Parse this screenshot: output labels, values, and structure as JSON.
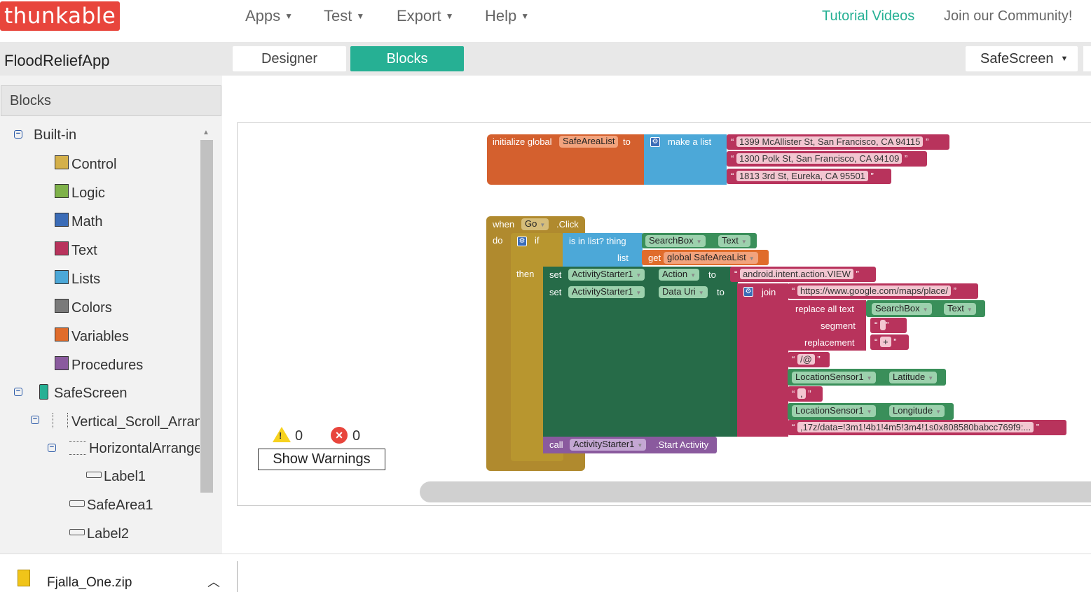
{
  "topbar": {
    "logo": "thunkable",
    "menus": [
      "Apps",
      "Test",
      "Export",
      "Help"
    ],
    "tutorial": "Tutorial Videos",
    "community": "Join our Community!"
  },
  "project": {
    "name": "FloodReliefApp",
    "tabs": {
      "designer": "Designer",
      "blocks": "Blocks"
    },
    "screen": "SafeScreen"
  },
  "sidebar": {
    "title": "Blocks",
    "builtin": "Built-in",
    "builtin_items": [
      {
        "label": "Control",
        "color": "#d4b04a"
      },
      {
        "label": "Logic",
        "color": "#7fb24a"
      },
      {
        "label": "Math",
        "color": "#3b6cb7"
      },
      {
        "label": "Text",
        "color": "#b8335c"
      },
      {
        "label": "Lists",
        "color": "#4ca8d8"
      },
      {
        "label": "Colors",
        "color": "#7a7a7a"
      },
      {
        "label": "Variables",
        "color": "#e06c2b"
      },
      {
        "label": "Procedures",
        "color": "#8a5a9e"
      }
    ],
    "components": {
      "screen": "SafeScreen",
      "vsa": "Vertical_Scroll_Arran",
      "ha": "HorizontalArrange",
      "label1": "Label1",
      "safearea1": "SafeArea1",
      "label2": "Label2"
    }
  },
  "warnings": {
    "warning_count": "0",
    "error_count": "0",
    "button": "Show Warnings"
  },
  "download": {
    "filename": "Fjalla_One.zip"
  },
  "blocks": {
    "init": {
      "prefix": "initialize global",
      "var": "SafeAreaList",
      "to": "to",
      "make_list": "make a list",
      "items": [
        "1399 McAllister St, San Francisco, CA 94115",
        "1300 Polk St, San Francisco, CA 94109",
        "1813 3rd St, Eureka, CA 95501"
      ]
    },
    "event": {
      "when": "when",
      "component": "Go",
      "event": ".Click",
      "do": "do",
      "if": "if",
      "then": "then",
      "is_in_list": "is in list? thing",
      "list": "list",
      "searchbox": "SearchBox",
      "text": "Text",
      "get": "get",
      "global_var": "global SafeAreaList",
      "set": "set",
      "activity": "ActivityStarter1",
      "action": "Action",
      "to": "to",
      "action_value": "android.intent.action.VIEW",
      "data_uri": "Data Uri",
      "join": "join",
      "url": "https://www.google.com/maps/place/",
      "replace_all": "replace all text",
      "segment": "segment",
      "replacement": "replacement",
      "plus": "+",
      "at": "/@",
      "comma": ",",
      "location": "LocationSensor1",
      "latitude": "Latitude",
      "longitude": "Longitude",
      "tail": ",17z/data=!3m1!4b1!4m5!3m4!1s0x808580babcc769f9:...",
      "call": "call",
      "start_activity": ".Start Activity"
    }
  }
}
